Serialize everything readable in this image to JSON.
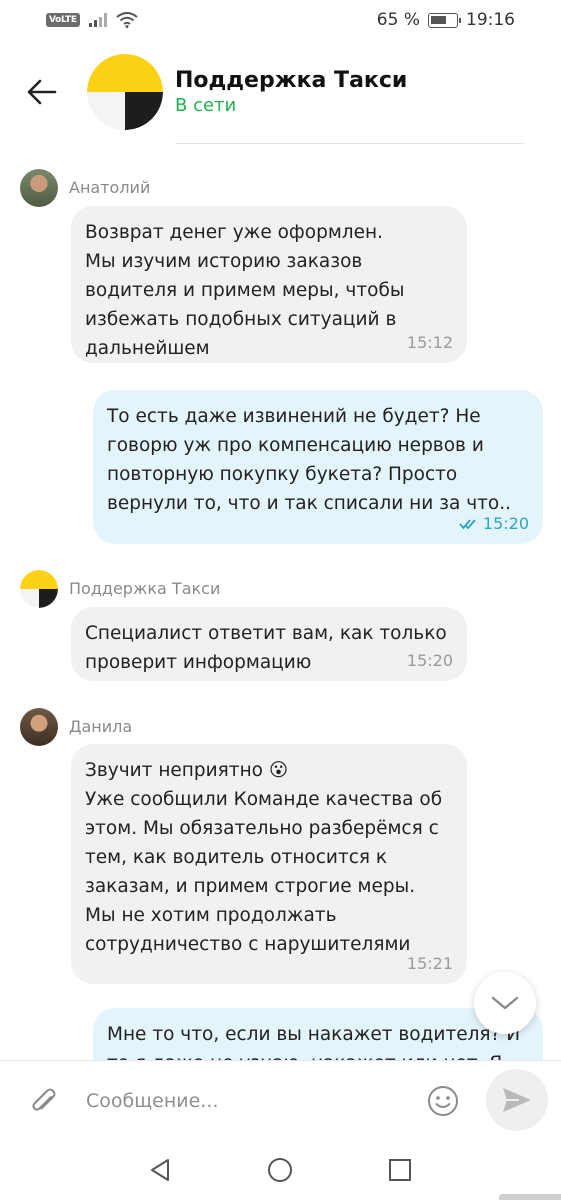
{
  "status_bar": {
    "network_badge": "VoLTE",
    "battery_percent": "65 %",
    "time": "19:16",
    "battery_level": 0.65
  },
  "header": {
    "title": "Поддержка Такси",
    "status": "В сети",
    "status_color": "#23b14d"
  },
  "messages": [
    {
      "direction": "in",
      "sender": "Анатолий",
      "lines": [
        "Возврат денег уже оформлен.",
        "Мы изучим историю заказов",
        "водителя и примем меры, чтобы",
        "избежать подобных ситуаций в",
        "дальнейшем"
      ],
      "time": "15:12"
    },
    {
      "direction": "out",
      "lines": [
        "То есть даже извинений не будет? Не",
        "говорю уж про компенсацию нервов и",
        "повторную покупку букета? Просто",
        "вернули то, что и так списали ни за что.."
      ],
      "time": "15:20",
      "read": true
    },
    {
      "direction": "in",
      "sender": "Поддержка Такси",
      "lines": [
        "Специалист ответит вам, как только",
        "проверит информацию"
      ],
      "time": "15:20"
    },
    {
      "direction": "in",
      "sender": "Данила",
      "lines": [
        "Звучит неприятно 😮",
        "Уже сообщили Команде качества об",
        "этом. Мы обязательно разберёмся с",
        "тем, как водитель относится к",
        "заказам, и примем строгие меры.",
        "Мы не хотим продолжать",
        "сотрудничество с нарушителями"
      ],
      "time": "15:21"
    },
    {
      "direction": "out",
      "lines": [
        "Мне то что, если вы накажет водителя? И",
        "то я даже не узнаю, накажет или нет. Я"
      ],
      "time": ""
    }
  ],
  "input": {
    "placeholder": "Сообщение..."
  },
  "icons": {
    "back": "arrow-left-icon",
    "attach": "paperclip-icon",
    "emoji": "smiley-icon",
    "send": "send-icon",
    "scroll_down": "chevron-down-icon",
    "nav_back": "triangle-back-icon",
    "nav_home": "circle-home-icon",
    "nav_recent": "square-recent-icon"
  },
  "colors": {
    "incoming_bubble": "#f1f1f4",
    "outgoing_bubble": "#e3f5fa",
    "read_ticks": "#29a6c7",
    "brand_yellow": "#fcd214"
  }
}
